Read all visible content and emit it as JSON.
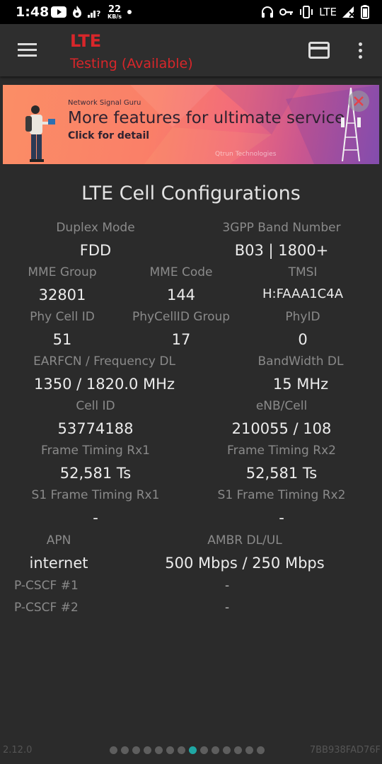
{
  "status_bar": {
    "time": "1:48",
    "net_speed_value": "22",
    "net_speed_unit": "KB/s",
    "network_type": "LTE",
    "icons_left": [
      "youtube-icon",
      "fire-icon",
      "signal-question-icon",
      "netspeed-indicator",
      "notification-dot"
    ],
    "icons_right": [
      "headset-icon",
      "key-icon",
      "vibrate-icon",
      "lte-signal-icon",
      "battery-icon"
    ]
  },
  "app_bar": {
    "title": "LTE",
    "subtitle": "Testing (Available)",
    "title_color": "#d8262a"
  },
  "banner": {
    "brand": "Network Signal Guru",
    "headline": "More features for ultimate service",
    "cta": "Click for detail",
    "footer": "Qtrun Technologies"
  },
  "section_title": "LTE Cell Configurations",
  "fields": {
    "duplex_mode": {
      "label": "Duplex Mode",
      "value": "FDD"
    },
    "band_number": {
      "label": "3GPP Band Number",
      "value": "B03 | 1800+"
    },
    "mme_group": {
      "label": "MME Group",
      "value": "32801"
    },
    "mme_code": {
      "label": "MME Code",
      "value": "144"
    },
    "tmsi": {
      "label": "TMSI",
      "value": "H:FAAA1C4A"
    },
    "phy_cell_id": {
      "label": "Phy Cell ID",
      "value": "51"
    },
    "phycellid_group": {
      "label": "PhyCellID Group",
      "value": "17"
    },
    "phyid": {
      "label": "PhyID",
      "value": "0"
    },
    "earfcn": {
      "label": "EARFCN / Frequency DL",
      "value": "1350 / 1820.0 MHz"
    },
    "bandwidth_dl": {
      "label": "BandWidth DL",
      "value": "15 MHz"
    },
    "cell_id": {
      "label": "Cell ID",
      "value": "53774188"
    },
    "enb_cell": {
      "label": "eNB/Cell",
      "value": "210055 / 108"
    },
    "frame_timing_rx1": {
      "label": "Frame Timing Rx1",
      "value": "52,581 Ts"
    },
    "frame_timing_rx2": {
      "label": "Frame Timing Rx2",
      "value": "52,581 Ts"
    },
    "s1_frame_timing_rx1": {
      "label": "S1 Frame Timing Rx1",
      "value": "-"
    },
    "s1_frame_timing_rx2": {
      "label": "S1 Frame Timing Rx2",
      "value": "-"
    },
    "apn": {
      "label": "APN",
      "value": "internet"
    },
    "ambr": {
      "label": "AMBR DL/UL",
      "value": "500 Mbps / 250 Mbps"
    },
    "pcscf1": {
      "label": "P-CSCF #1",
      "value": "-"
    },
    "pcscf2": {
      "label": "P-CSCF #2",
      "value": "-"
    }
  },
  "footer": {
    "version": "2.12.0",
    "device_id": "7BB938FAD76F",
    "page_count": 14,
    "active_page": 8,
    "active_color": "#1fa7a4"
  }
}
